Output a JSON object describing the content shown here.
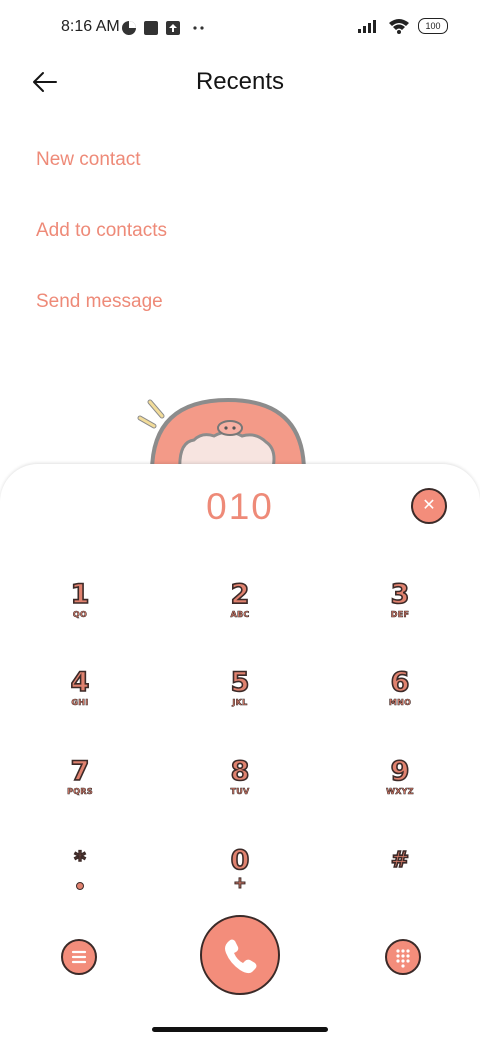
{
  "status_bar": {
    "time": "8:16 AM",
    "battery": "100"
  },
  "header": {
    "title": "Recents"
  },
  "actions": [
    {
      "label": "New contact"
    },
    {
      "label": "Add to contacts"
    },
    {
      "label": "Send message"
    }
  ],
  "dialer": {
    "number": "010",
    "keys": [
      {
        "digit": "1",
        "letters": "QO"
      },
      {
        "digit": "2",
        "letters": "ABC"
      },
      {
        "digit": "3",
        "letters": "DEF"
      },
      {
        "digit": "4",
        "letters": "GHI"
      },
      {
        "digit": "5",
        "letters": "JKL"
      },
      {
        "digit": "6",
        "letters": "MNO"
      },
      {
        "digit": "7",
        "letters": "PQRS"
      },
      {
        "digit": "8",
        "letters": "TUV"
      },
      {
        "digit": "9",
        "letters": "WXYZ"
      },
      {
        "digit": "*"
      },
      {
        "digit": "0",
        "letters": "+"
      },
      {
        "digit": "#"
      }
    ]
  },
  "colors": {
    "accent": "#ee8a78",
    "button": "#f38d7b",
    "outline": "#3a2a28"
  },
  "icons": [
    "back-arrow-icon",
    "clear-icon",
    "menu-icon",
    "phone-icon",
    "keypad-icon"
  ]
}
